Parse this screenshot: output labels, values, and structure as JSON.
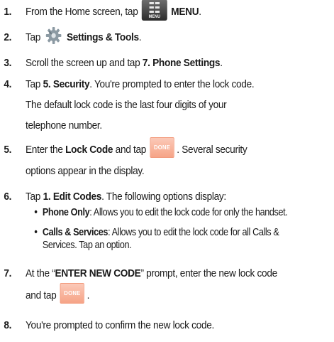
{
  "steps": [
    {
      "num": "1.",
      "pre": "From the Home screen, tap",
      "icon_label": "MENU",
      "bold": "MENU",
      "post": "."
    },
    {
      "num": "2.",
      "pre": "Tap",
      "bold": "Settings & Tools",
      "post": "."
    },
    {
      "num": "3.",
      "pre": "Scroll the screen up and tap",
      "bold": "7. Phone Settings",
      "post": "."
    },
    {
      "num": "4.",
      "pre": "Tap",
      "bold": "5. Security",
      "post": ". You're prompted to enter the lock code.",
      "line2": "The default lock code is the last four digits of your",
      "line3": "telephone number."
    },
    {
      "num": "5.",
      "pre": "Enter the",
      "bold": "Lock Code",
      "mid": "and tap",
      "button_label": "DONE",
      "post": ". Several security",
      "line2": "options appear in the display."
    },
    {
      "num": "6.",
      "pre": "Tap",
      "bold": "1. Edit Codes",
      "post": ". The following options display:"
    },
    {
      "num": "7.",
      "pre": "At the “",
      "bold": "ENTER NEW CODE",
      "post": "” prompt, enter the new lock code",
      "line2_pre": "and tap",
      "button_label": "DONE",
      "line2_post": "."
    },
    {
      "num": "8.",
      "pre": "You're prompted to confirm the new lock code."
    }
  ],
  "sub_options": [
    {
      "bullet": "•",
      "bold": "Phone Only",
      "text": ": Allows you to edit the lock code for only the handset."
    },
    {
      "bullet": "•",
      "bold": "Calls & Services",
      "text": ": Allows you to edit the lock code for all Calls &",
      "line2": "Services. Tap an option."
    }
  ],
  "colors": {
    "text": "#1a1a1a",
    "done_button": "#f6a487",
    "menu_icon": "#3a3a3a",
    "gear_icon": "#8c9aa3"
  }
}
